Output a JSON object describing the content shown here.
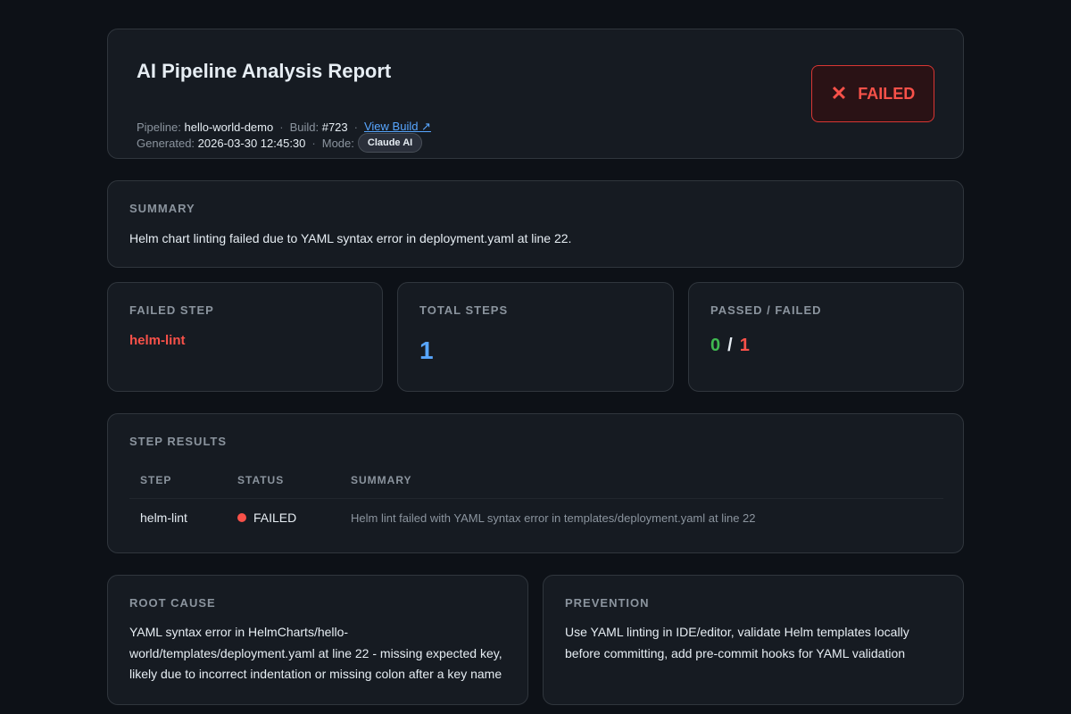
{
  "header": {
    "title": "AI Pipeline Analysis Report",
    "pipeline_label": "Pipeline:",
    "pipeline_name": "hello-world-demo",
    "build_label": "Build:",
    "build_number": "#723",
    "view_build_link": "View Build ↗",
    "generated_label": "Generated:",
    "generated_value": "2026-03-30 12:45:30",
    "mode_label": "Mode:",
    "mode_value": "Claude AI",
    "separator": "·",
    "status_label": "FAILED",
    "status_icon": "✕",
    "status_color": "#f85149"
  },
  "summary": {
    "title": "SUMMARY",
    "text": "Helm chart linting failed due to YAML syntax error in deployment.yaml at line 22."
  },
  "stats": {
    "failed_step": {
      "title": "FAILED STEP",
      "value": "helm-lint"
    },
    "total_steps": {
      "title": "TOTAL STEPS",
      "value": "1"
    },
    "passed_failed": {
      "title": "PASSED / FAILED",
      "passed": "0",
      "slash": "/",
      "failed": "1"
    }
  },
  "step_results": {
    "title": "STEP RESULTS",
    "columns": [
      "STEP",
      "STATUS",
      "SUMMARY"
    ],
    "rows": [
      {
        "step": "helm-lint",
        "status": "FAILED",
        "summary": "Helm lint failed with YAML syntax error in templates/deployment.yaml at line 22"
      }
    ]
  },
  "root_cause": {
    "title": "ROOT CAUSE",
    "text": "YAML syntax error in HelmCharts/hello-world/templates/deployment.yaml at line 22 - missing expected key, likely due to incorrect indentation or missing colon after a key name"
  },
  "prevention": {
    "title": "PREVENTION",
    "text": "Use YAML linting in IDE/editor, validate Helm templates locally before committing, add pre-commit hooks for YAML validation"
  },
  "colors": {
    "background": "#0d1117",
    "card": "#161b22",
    "fail": "#f85149",
    "pass": "#3fb950",
    "accent": "#58a6ff"
  }
}
